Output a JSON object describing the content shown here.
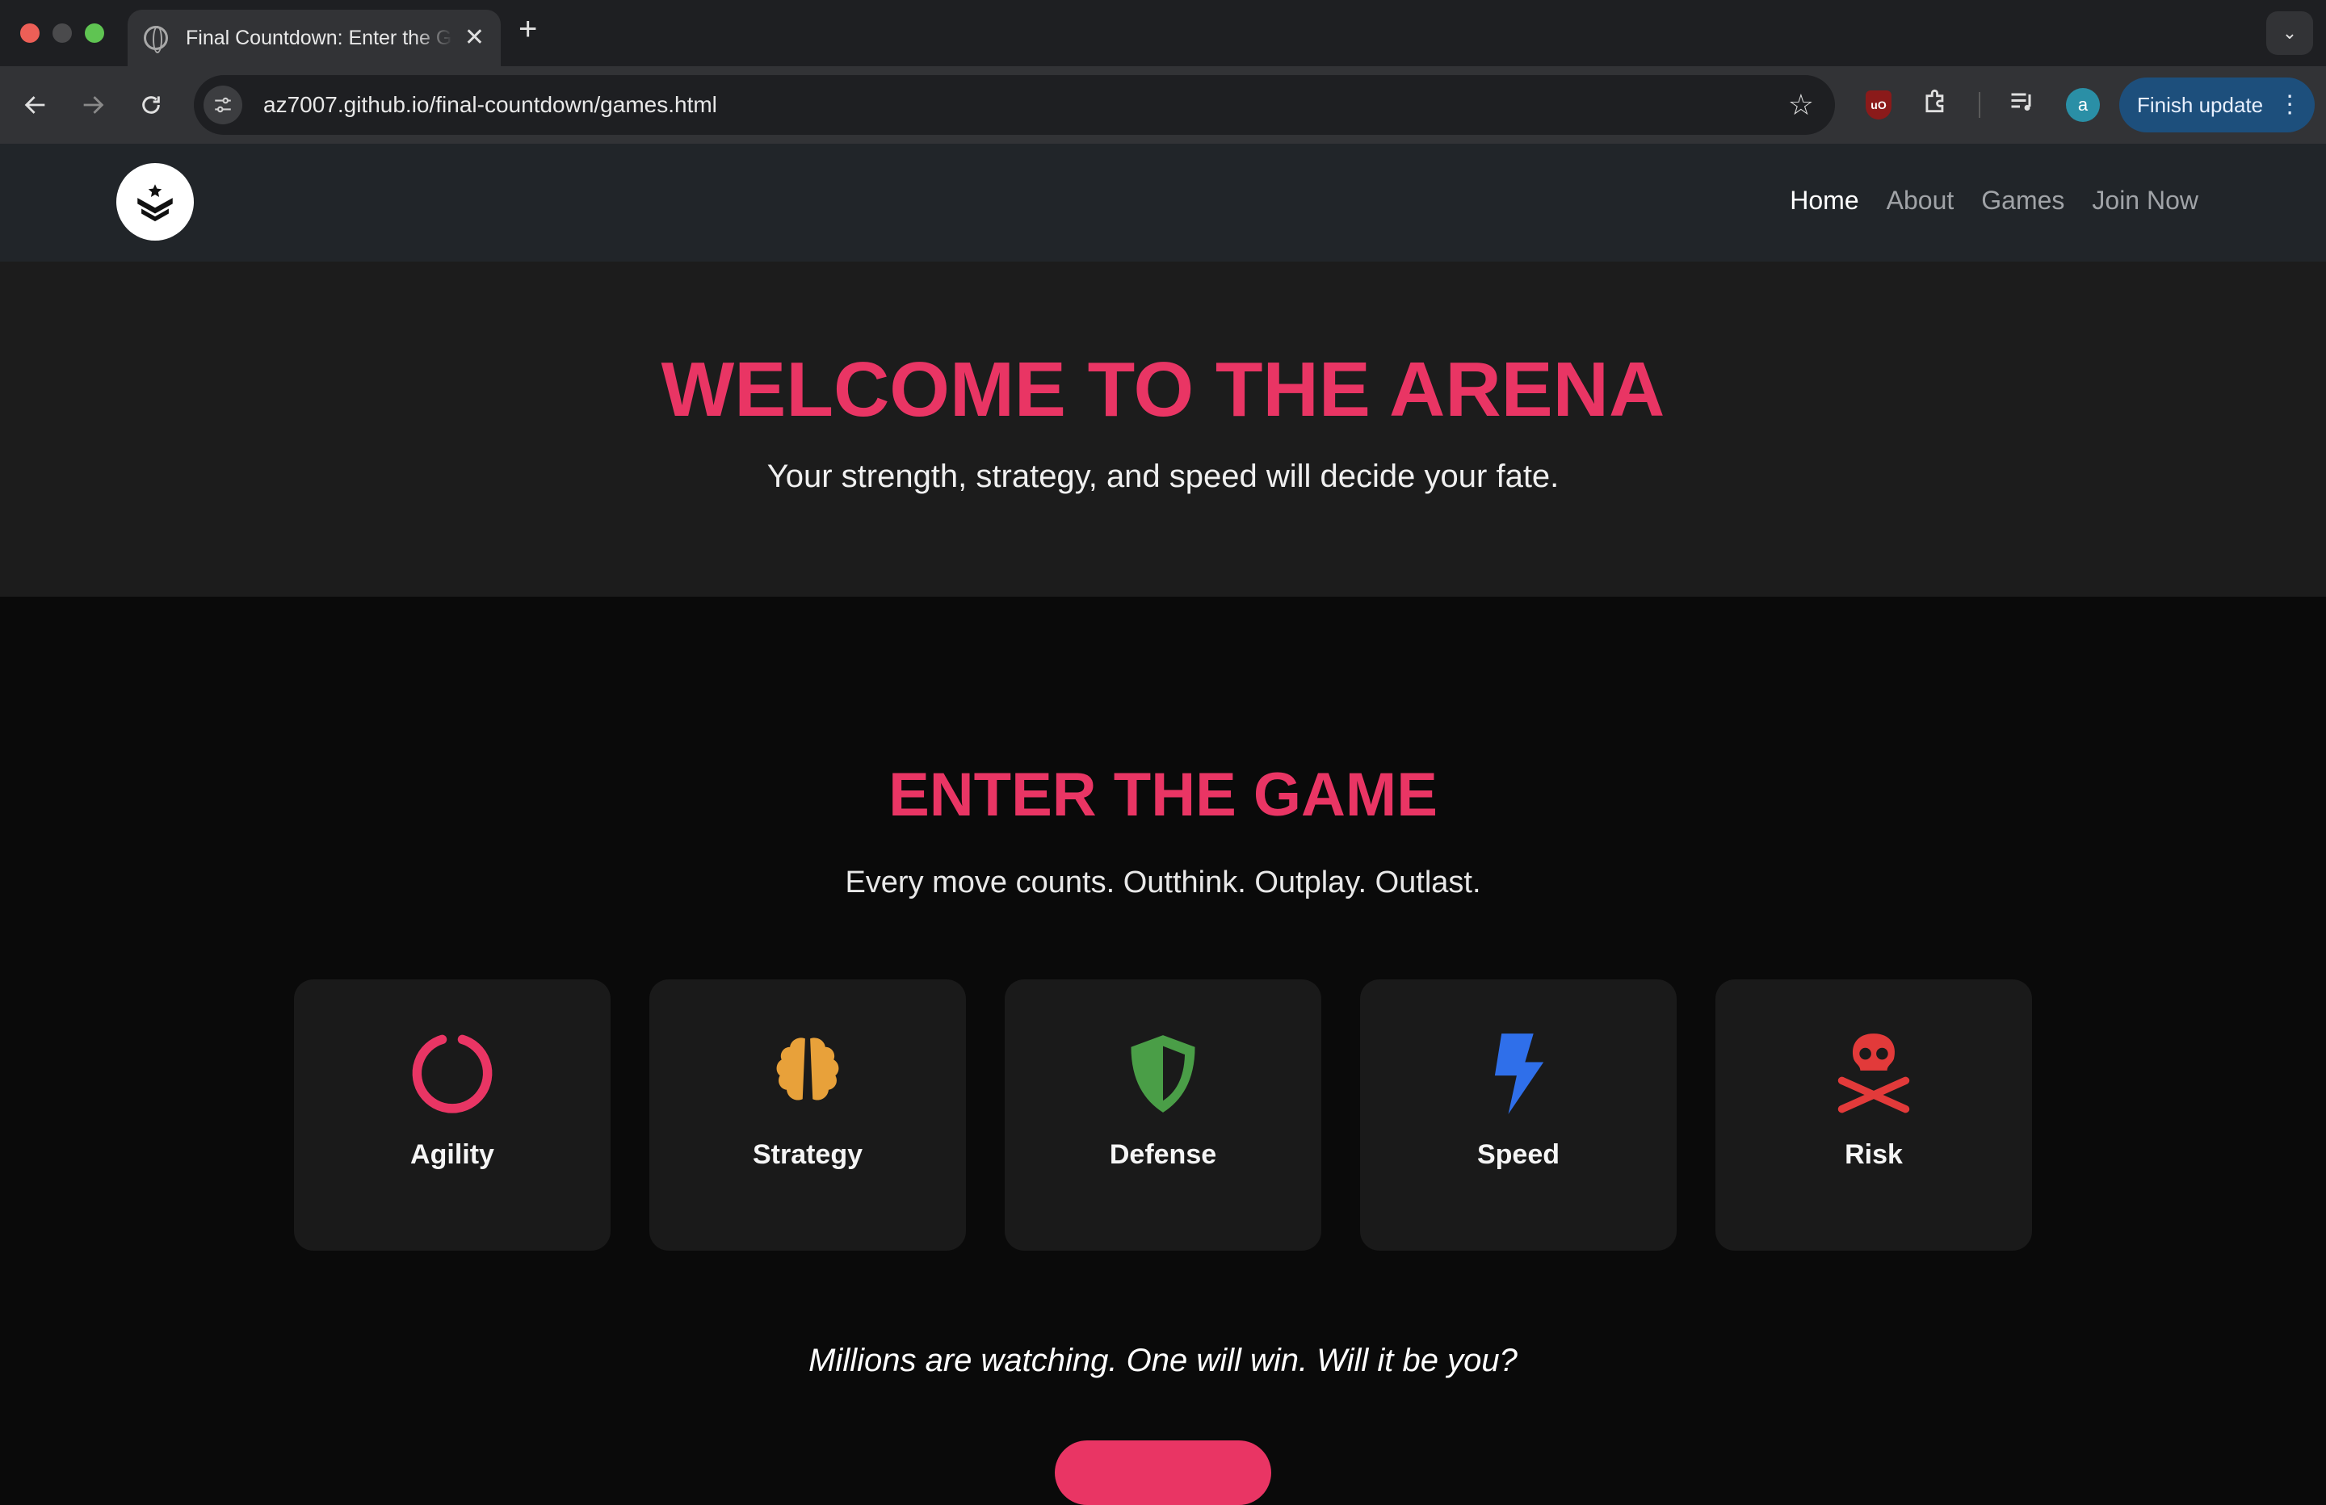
{
  "browser": {
    "tab_title": "Final Countdown: Enter the Game",
    "url": "az7007.github.io/final-countdown/games.html",
    "profile_initial": "a",
    "update_label": "Finish update",
    "ublock_label": "uO"
  },
  "site": {
    "nav": {
      "home": "Home",
      "about": "About",
      "games": "Games",
      "join": "Join Now"
    },
    "hero": {
      "title": "WELCOME TO THE ARENA",
      "subtitle": "Your strength, strategy, and speed will decide your fate."
    },
    "game": {
      "title": "ENTER THE GAME",
      "subtitle": "Every move counts. Outthink. Outplay. Outlast.",
      "cards": [
        {
          "label": "Agility",
          "icon": "circle-notch-icon",
          "color": "#e93564"
        },
        {
          "label": "Strategy",
          "icon": "brain-icon",
          "color": "#e8a13a"
        },
        {
          "label": "Defense",
          "icon": "shield-icon",
          "color": "#4a9e47"
        },
        {
          "label": "Speed",
          "icon": "bolt-icon",
          "color": "#2f6fea"
        },
        {
          "label": "Risk",
          "icon": "skull-crossbones-icon",
          "color": "#e23a3a"
        }
      ],
      "tagline": "Millions are watching. One will win. Will it be you?"
    }
  }
}
